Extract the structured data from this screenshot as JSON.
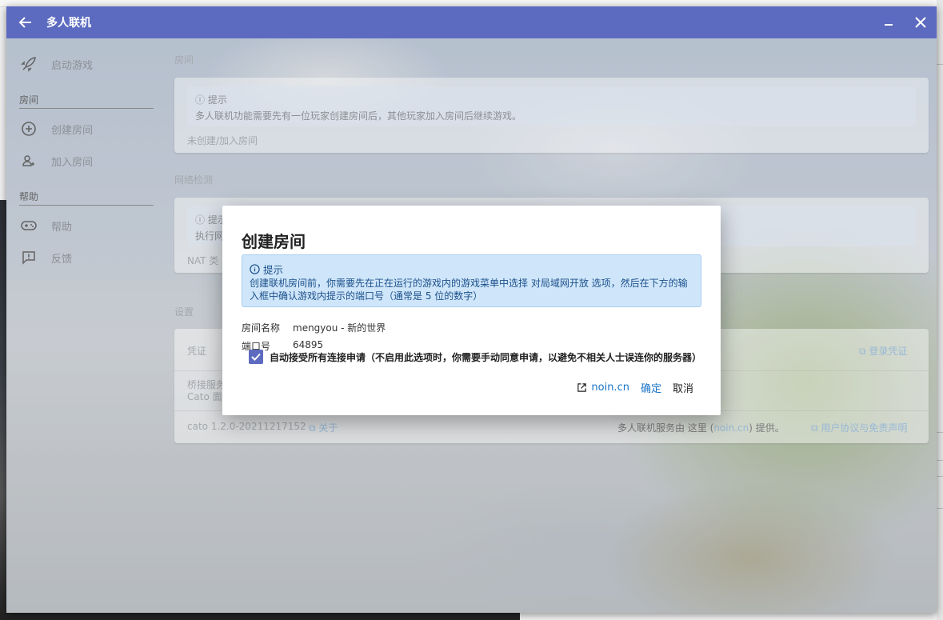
{
  "window": {
    "title": "多人联机"
  },
  "sidebar": {
    "launch_label": "启动游戏",
    "room_header": "房间",
    "create_room_label": "创建房间",
    "join_room_label": "加入房间",
    "help_header": "帮助",
    "help_label": "帮助",
    "feedback_label": "反馈"
  },
  "content": {
    "room_section": "房间",
    "room_hint_title": "提示",
    "room_hint_text": "多人联机功能需要先有一位玩家创建房间后，其他玩家加入房间后继续游戏。",
    "room_status": "未创建/加入房间",
    "network_section": "网络检测",
    "network_hint_title": "提示",
    "network_hint_text": "执行网",
    "nat_label": "NAT 类",
    "settings_section": "设置",
    "credential_label": "凭证",
    "login_link": "登录凭证",
    "bridge_label": "桥接服务",
    "bridge_sub": "Cato 面",
    "version_text": "cato 1.2.0-20211217152",
    "about_link": "关于",
    "provider_prefix": "多人联机服务由 这里 (",
    "provider_link": "noin.cn",
    "provider_suffix": ") 提供。",
    "terms_link": "用户协议与免责声明"
  },
  "dialog": {
    "title": "创建房间",
    "hint_title": "提示",
    "hint_text": "创建联机房间前，你需要先在正在运行的游戏内的游戏菜单中选择 对局域网开放 选项，然后在下方的输入框中确认游戏内提示的端口号（通常是 5 位的数字）",
    "room_name_key": "房间名称",
    "room_name_value": "mengyou - 新的世界",
    "port_key": "端口号",
    "port_value": "64895",
    "auto_accept_label": "自动接受所有连接申请（不启用此选项时，你需要手动同意申请，以避免不相关人士误连你的服务器）",
    "auto_accept_checked": true,
    "site_link": "noin.cn",
    "confirm_label": "确定",
    "cancel_label": "取消"
  },
  "colors": {
    "accent": "#5c6bc0",
    "hint_bg": "#cfe6fa",
    "link": "#1a73c8"
  }
}
